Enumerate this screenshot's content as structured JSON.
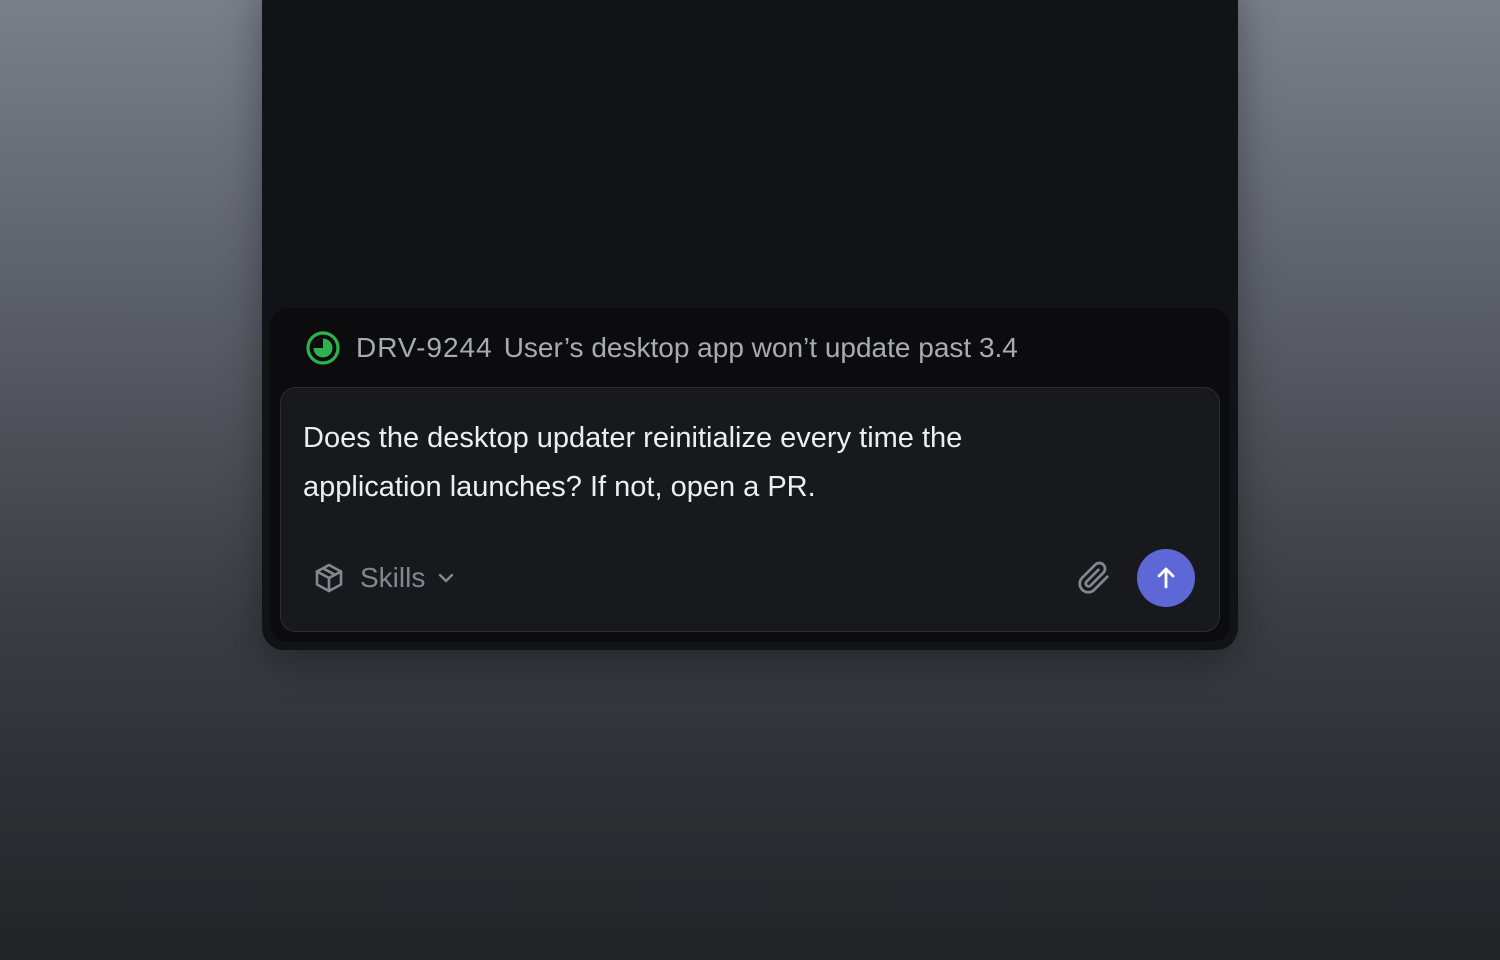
{
  "issue": {
    "id": "DRV-9244",
    "title": "User’s desktop app won’t update past 3.4",
    "status_icon": "in-progress-icon",
    "status_color": "#2fb24c"
  },
  "composer": {
    "message": "Does the desktop updater reinitialize every time the application launches? If not, open a PR.",
    "skills_label": "Skills",
    "skills_icon": "cube-icon",
    "attach_icon": "paperclip-icon",
    "send_icon": "arrow-up-icon",
    "send_color": "#5d67d6"
  }
}
